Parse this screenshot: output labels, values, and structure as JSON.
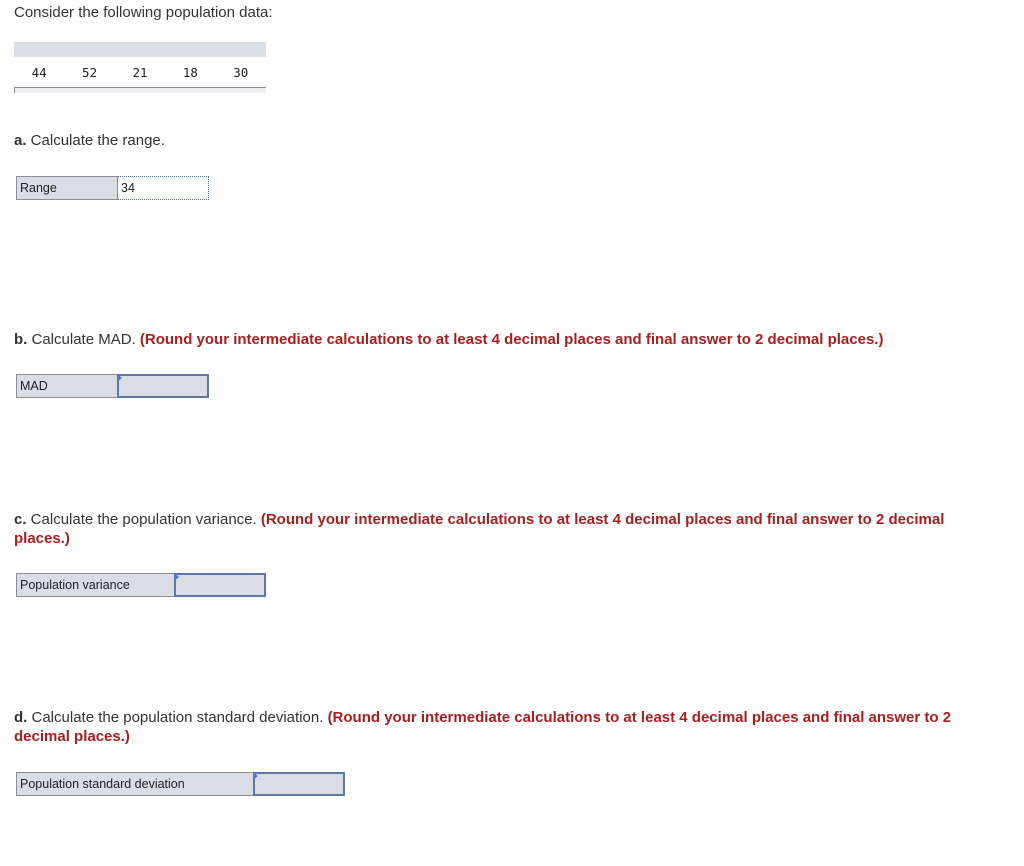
{
  "intro": "Consider the following population data:",
  "population_data": [
    "44",
    "52",
    "21",
    "18",
    "30"
  ],
  "questions": {
    "a": {
      "letter": "a.",
      "text": " Calculate the range.",
      "note": "",
      "answer_label": "Range",
      "answer_value": "34"
    },
    "b": {
      "letter": "b.",
      "text": " Calculate MAD. ",
      "note": "(Round your intermediate calculations to at least 4 decimal places and final answer to 2 decimal places.)",
      "answer_label": "MAD",
      "answer_value": ""
    },
    "c": {
      "letter": "c.",
      "text": " Calculate the population variance. ",
      "note": "(Round your intermediate calculations to at least 4 decimal places and final answer to 2 decimal places.)",
      "answer_label": "Population variance",
      "answer_value": ""
    },
    "d": {
      "letter": "d.",
      "text": " Calculate the population standard deviation. ",
      "note": "(Round your intermediate calculations to at least 4 decimal places and final answer to 2 decimal places.)",
      "answer_label": "Population standard deviation",
      "answer_value": ""
    }
  },
  "colors": {
    "note_red": "#a7201f",
    "input_border": "#5b78a6",
    "label_bg": "#d9dde6"
  }
}
